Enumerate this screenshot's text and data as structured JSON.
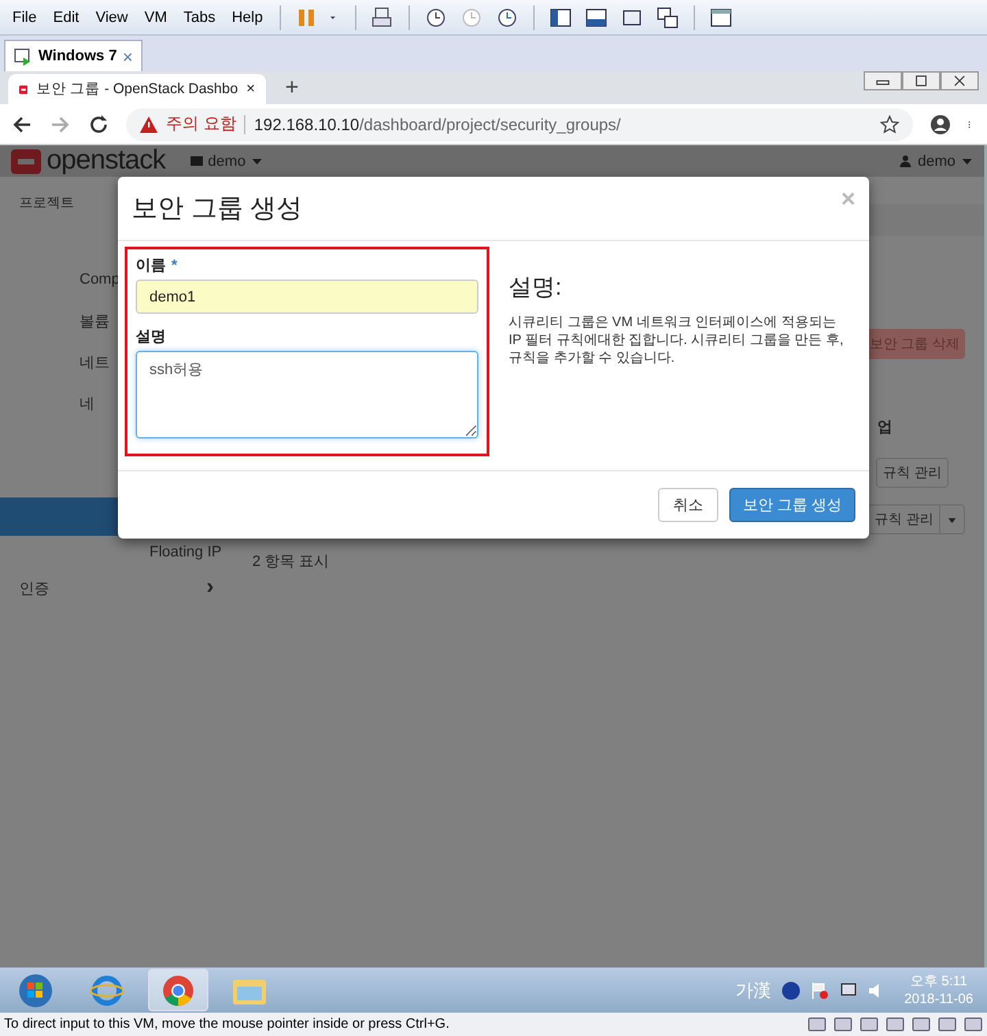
{
  "vm_menu": [
    "File",
    "Edit",
    "View",
    "VM",
    "Tabs",
    "Help"
  ],
  "vm_tab": {
    "label": "Windows 7",
    "close": "×"
  },
  "browser_tab": {
    "title": "보안 그룹 - OpenStack Dashbo",
    "close": "×",
    "new_tab": "+"
  },
  "address_bar": {
    "warning": "주의 요함",
    "url_host": "192.168.10.10",
    "url_path": "/dashboard/project/security_groups/"
  },
  "header": {
    "logo": "openstack",
    "project": "demo",
    "user": "demo"
  },
  "sidebar": {
    "heading": "프로젝트",
    "items": [
      {
        "label": "Comp"
      },
      {
        "label": "볼륨"
      },
      {
        "label": "네트"
      },
      {
        "label": "네"
      }
    ],
    "sub_item": "Floating IP",
    "section": "인증",
    "section_arrow": "›"
  },
  "main": {
    "delete_button": "보안 그룹 삭제",
    "column_header": "업",
    "row_buttons": [
      {
        "label": "규칙 관리",
        "caret": false
      },
      {
        "label": "규칙 관리",
        "caret": true
      }
    ],
    "count": "2 항목 표시"
  },
  "modal": {
    "title": "보안 그룹 생성",
    "close": "×",
    "name_label": "이름",
    "required_mark": "*",
    "name_value": "demo1",
    "description_label": "설명",
    "description_value": "ssh허용",
    "help_title": "설명:",
    "help_text": "시큐리티 그룹은 VM 네트워크 인터페이스에 적용되는 IP 필터 규칙에대한 집합니다. 시큐리티 그룹을 만든 후, 규칙을 추가할 수 있습니다.",
    "cancel": "취소",
    "submit": "보안 그룹 생성"
  },
  "taskbar": {
    "ime": "가漢",
    "time": "오후 5:11",
    "date": "2018-11-06"
  },
  "status_bar": "To direct input to this VM, move the mouse pointer inside or press Ctrl+G."
}
